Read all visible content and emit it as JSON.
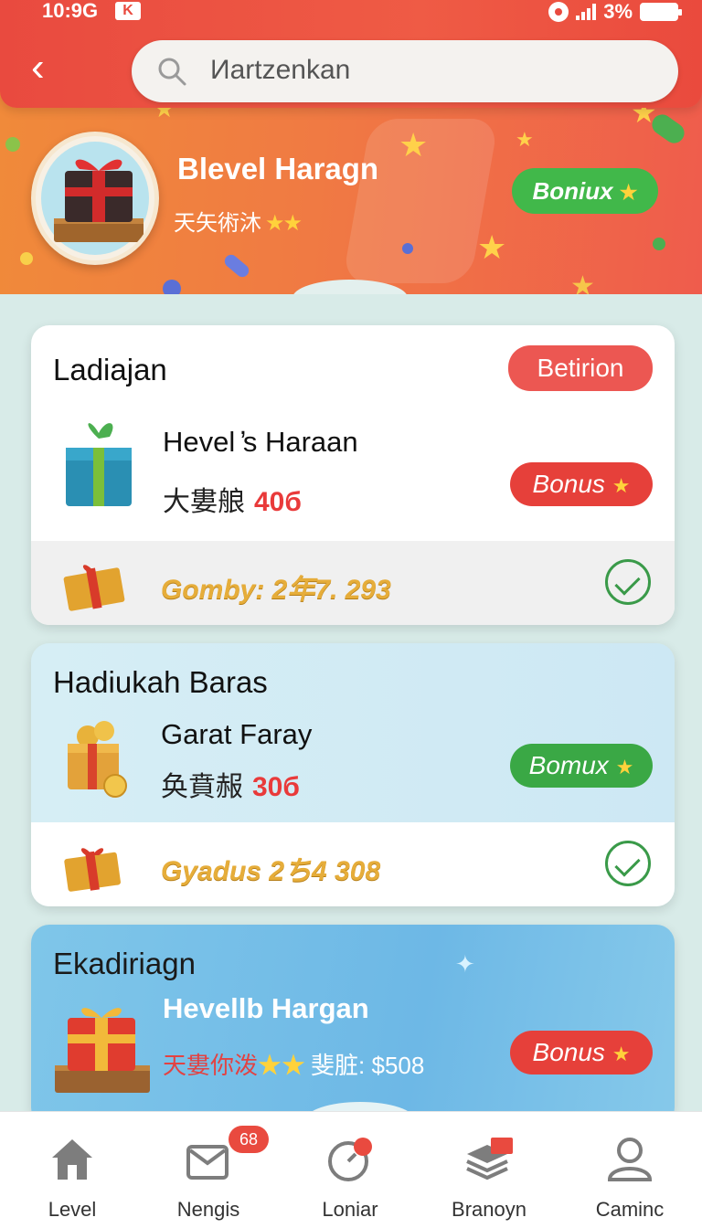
{
  "status": {
    "time": "10:9G",
    "battery": "3%"
  },
  "header": {
    "search_placeholder": "Иartzenkan"
  },
  "hero": {
    "title": "Blevel Haragn",
    "subtitle": "天矢術沐",
    "stars": "★★",
    "bonus_label": "Boniux",
    "bonus_star": "★"
  },
  "cards": [
    {
      "title": "Ladiajan",
      "badge": "Betirion",
      "item_name": "Hevel ̓s Haraan",
      "item_sub": "大婁艆",
      "item_price": "40б",
      "bonus_label": "Bonus",
      "bonus_star": "★",
      "footer_text": "Gomby: 2年7. 293"
    },
    {
      "title": "Hadiukah Baras",
      "item_name": "Garat Faray",
      "item_sub": "奂賁赧",
      "item_price": "30б",
      "bonus_label": "Bomux",
      "bonus_star": "★",
      "footer_text": "Gyadus 2ち4 308"
    },
    {
      "title": "Ekadiriagn",
      "item_name": "Hevellb Hargan",
      "item_sub": "天婁你泼",
      "stars": "★★",
      "item_meta": "斐脏: $508",
      "bonus_label": "Bonus",
      "bonus_star": "★"
    }
  ],
  "nav": {
    "items": [
      {
        "label": "Level",
        "icon": "home-icon"
      },
      {
        "label": "Nengis",
        "icon": "mail-icon",
        "badge": "68"
      },
      {
        "label": "Loniar",
        "icon": "timer-icon"
      },
      {
        "label": "Branoyn",
        "icon": "stack-icon"
      },
      {
        "label": "Caminc",
        "icon": "profile-icon"
      }
    ]
  },
  "colors": {
    "primary_red": "#e94a3f",
    "hero_orange": "#f08a3a",
    "bonus_green": "#3aa845",
    "gold_text": "#e6ad3a"
  }
}
